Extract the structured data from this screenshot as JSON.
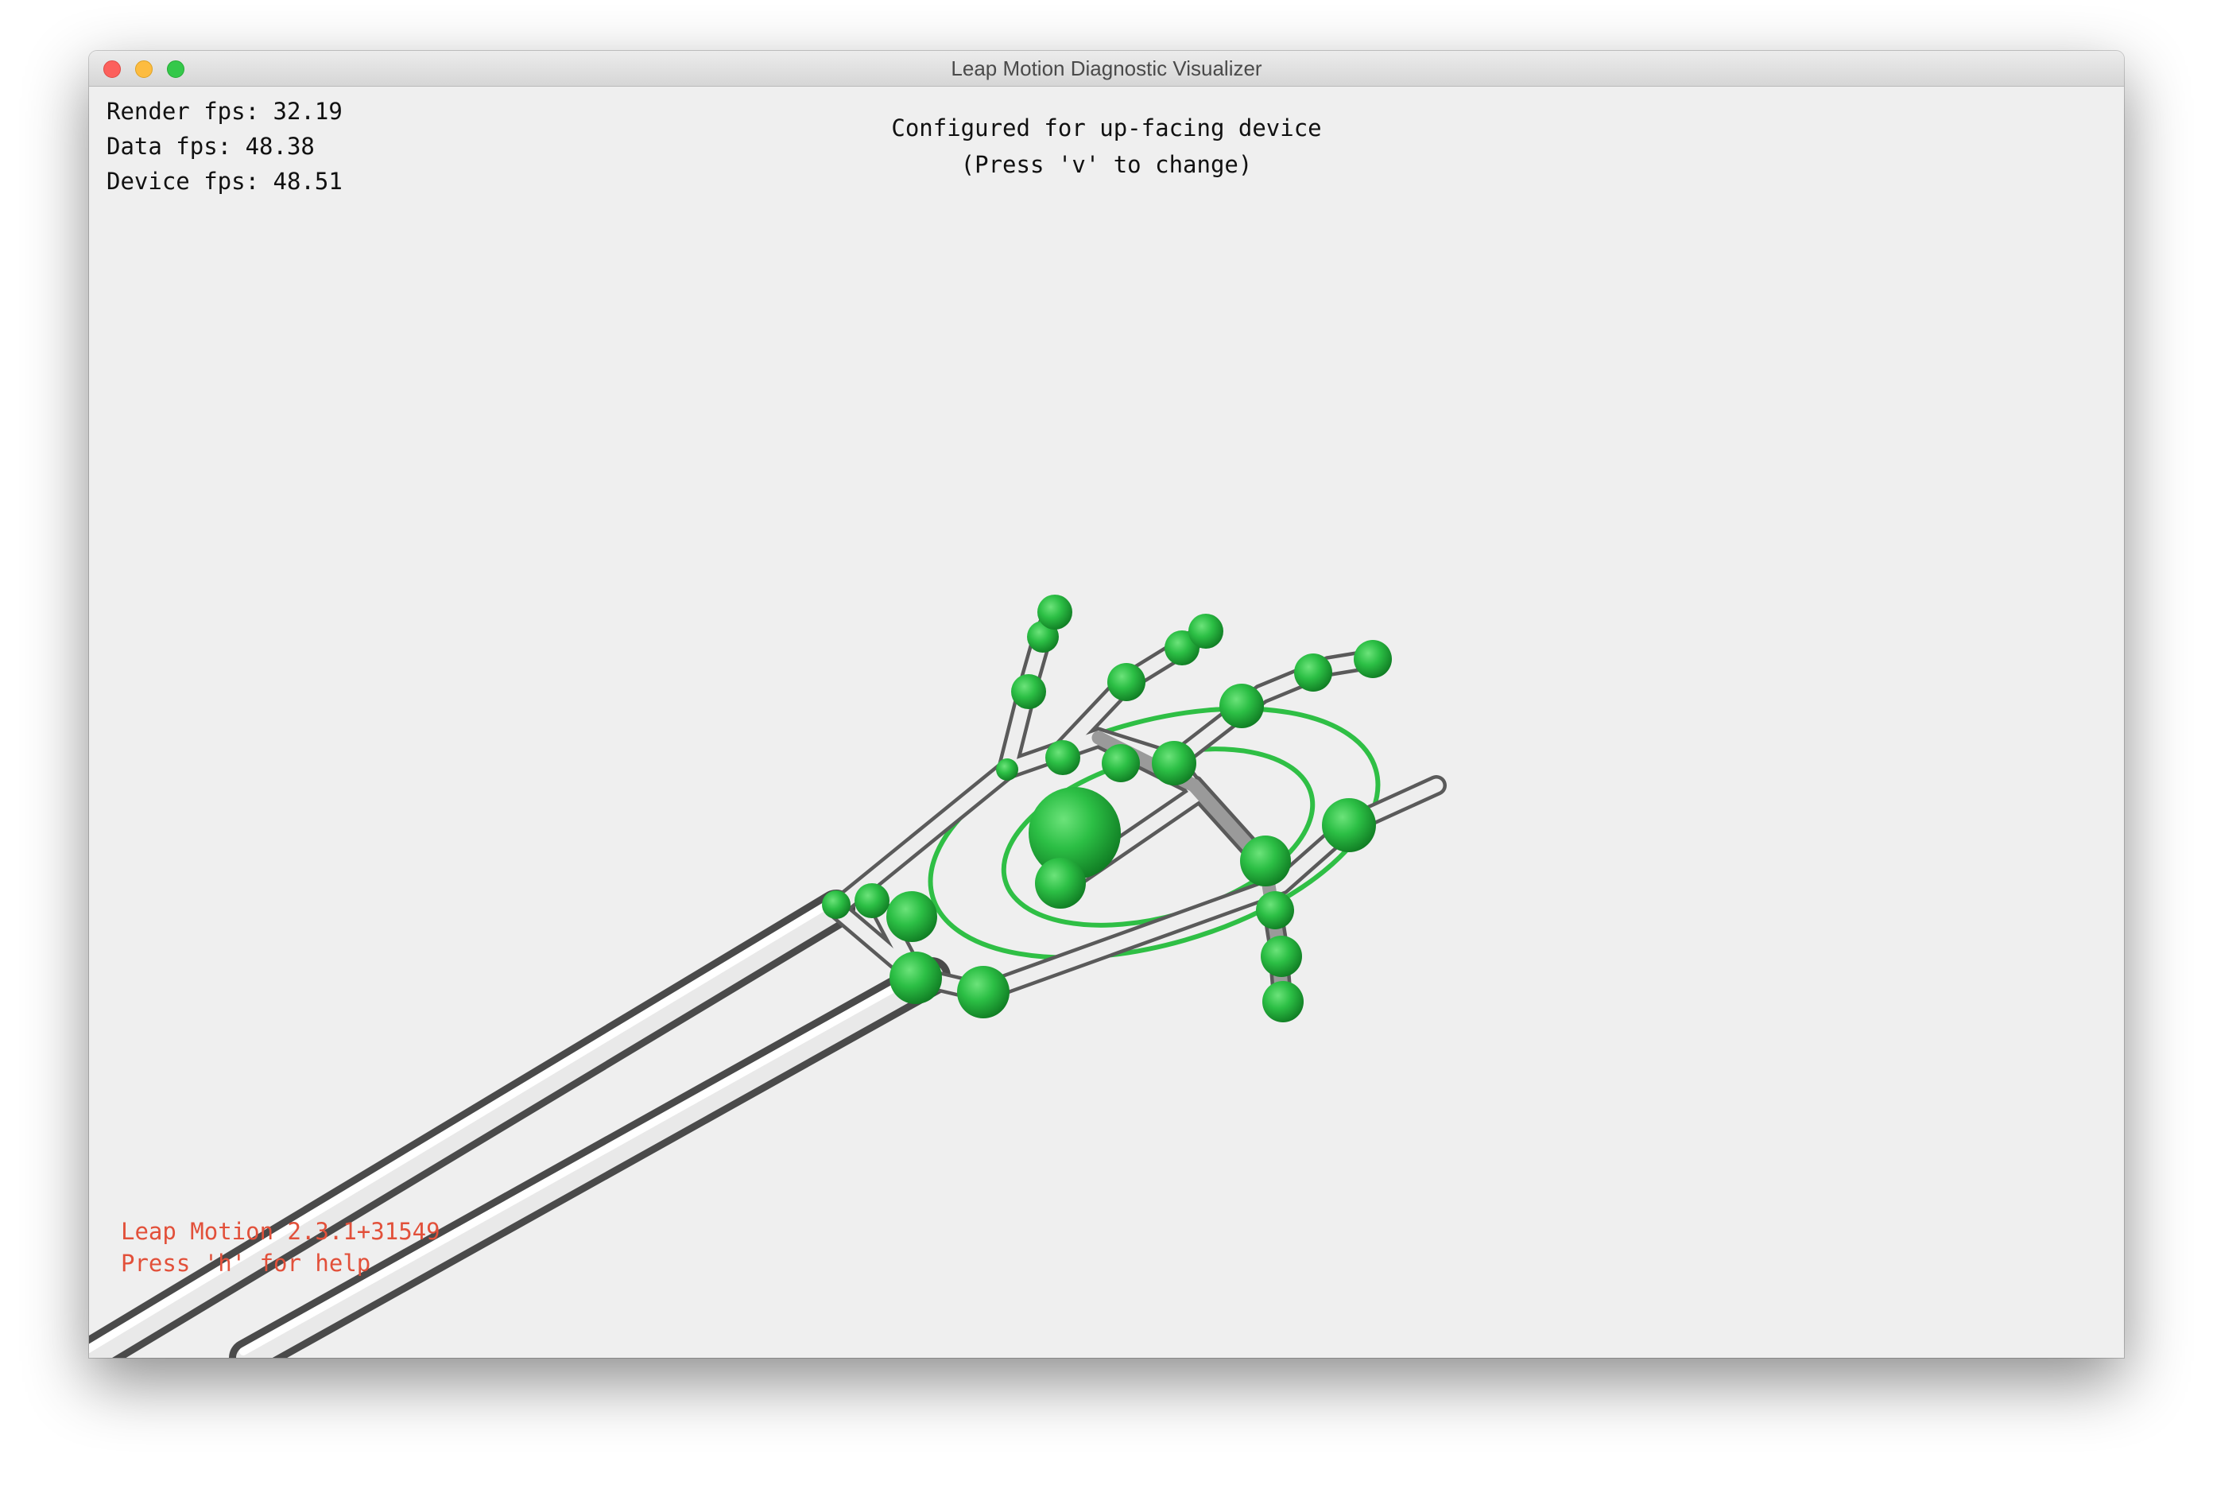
{
  "window": {
    "title": "Leap Motion Diagnostic Visualizer"
  },
  "stats": {
    "render_fps": "Render fps: 32.19",
    "data_fps": "Data fps: 48.38",
    "device_fps": "Device fps: 48.51"
  },
  "config": {
    "line1": "Configured for up-facing device",
    "line2": "(Press 'v' to change)"
  },
  "footer": {
    "version": "Leap Motion 2.3.1+31549",
    "help": "Press 'h' for help"
  },
  "colors": {
    "joint": "#2fbf45",
    "bone": "#e6e6e6",
    "footer_text": "#e2503a",
    "background": "#efefef"
  }
}
